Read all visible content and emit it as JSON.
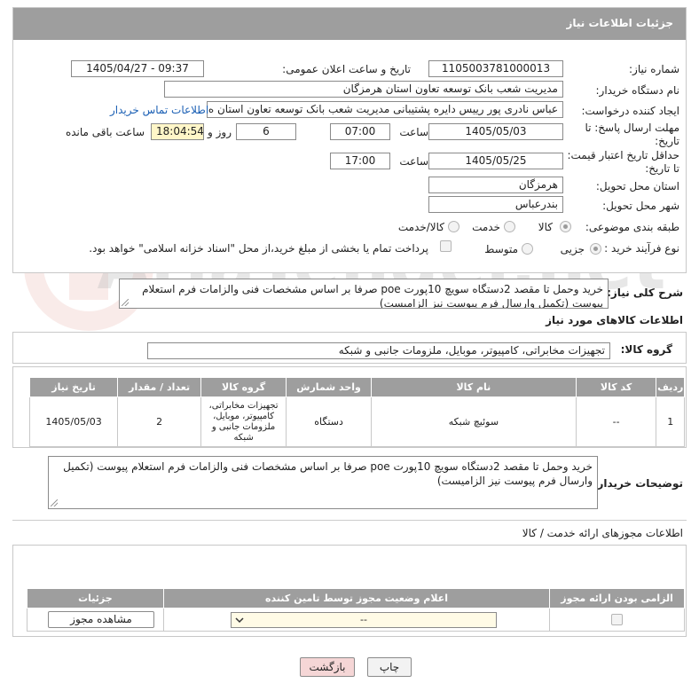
{
  "header": {
    "title": "جزئیات اطلاعات نیاز"
  },
  "form": {
    "need_number_label": "شماره نیاز:",
    "need_number": "1105003781000013",
    "announce_label": "تاریخ و ساعت اعلان عمومی:",
    "announce_value": "1405/04/27 - 09:37",
    "buyer_org_label": "نام دستگاه خریدار:",
    "buyer_org": "مدیریت شعب بانک توسعه تعاون استان هرمزگان",
    "creator_label": "ایجاد کننده درخواست:",
    "creator": "عباس نادری پور رییس دایره پشتیبانی مدیریت شعب بانک توسعه تعاون استان ه",
    "contact_link": "اطلاعات تماس خریدار",
    "deadline_label_1": "مهلت ارسال پاسخ: تا",
    "deadline_label_2": "تاریخ:",
    "deadline_date": "1405/05/03",
    "time_label": "ساعت",
    "deadline_time": "07:00",
    "days_value": "6",
    "days_label": "روز و",
    "remaining_time": "18:04:54",
    "remaining_label": "ساعت باقی مانده",
    "validity_label_1": "حداقل تاریخ اعتبار قیمت:",
    "validity_label_2": "تا تاریخ:",
    "validity_date": "1405/05/25",
    "validity_time": "17:00",
    "province_label": "استان محل تحویل:",
    "province": "هرمزگان",
    "city_label": "شهر محل تحویل:",
    "city": "بندرعباس",
    "category_label": "طبقه بندی موضوعی:",
    "category_opt1": "کالا",
    "category_opt2": "خدمت",
    "category_opt3": "کالا/خدمت",
    "process_label": "نوع فرآیند خرید :",
    "process_opt1": "جزیی",
    "process_opt2": "متوسط",
    "payment_note": "پرداخت تمام یا بخشی از مبلغ خرید،از محل \"اسناد خزانه اسلامی\" خواهد بود."
  },
  "description": {
    "label": "شرح کلی نیاز:",
    "text": "خرید وحمل تا مقصد 2دستگاه سویچ 10پورت poe صرفا بر اساس مشخصات فنی والزامات فرم استعلام پیوست (تکمیل وارسال فرم پیوست نیز الزامیست)"
  },
  "goods_info": {
    "title": "اطلاعات کالاهای مورد نیاز",
    "group_label": "گروه کالا:",
    "group_value": "تجهیزات مخابراتی، کامپیوتر، موبایل، ملزومات جانبی و شبکه"
  },
  "goods_table": {
    "headers": [
      "ردیف",
      "کد کالا",
      "نام کالا",
      "واحد شمارش",
      "گروه کالا",
      "تعداد / مقدار",
      "تاریخ نیاز"
    ],
    "rows": [
      {
        "row": "1",
        "code": "--",
        "name": "سوئیچ شبکه",
        "unit": "دستگاه",
        "group": "تجهیزات مخابراتی، کامپیوتر، موبایل، ملزومات جانبی و شبکه",
        "qty": "2",
        "date": "1405/05/03"
      }
    ]
  },
  "buyer_notes": {
    "label": "توضیحات خریدار:",
    "text": "خرید وحمل تا مقصد 2دستگاه سویچ 10پورت poe صرفا بر اساس مشخصات فنی والزامات فرم استعلام پیوست (تکمیل وارسال فرم پیوست نیز الزامیست)"
  },
  "permits": {
    "title": "اطلاعات مجوزهای ارائه خدمت / کالا",
    "headers": [
      "الزامی بودن ارائه مجوز",
      "اعلام وضعیت مجوز توسط تامین کننده",
      "جزئیات"
    ],
    "select_value": "--",
    "view_button": "مشاهده مجوز"
  },
  "footer": {
    "print_button": "چاپ",
    "back_button": "بازگشت"
  },
  "watermark": {
    "text": "AriaTender.net"
  }
}
